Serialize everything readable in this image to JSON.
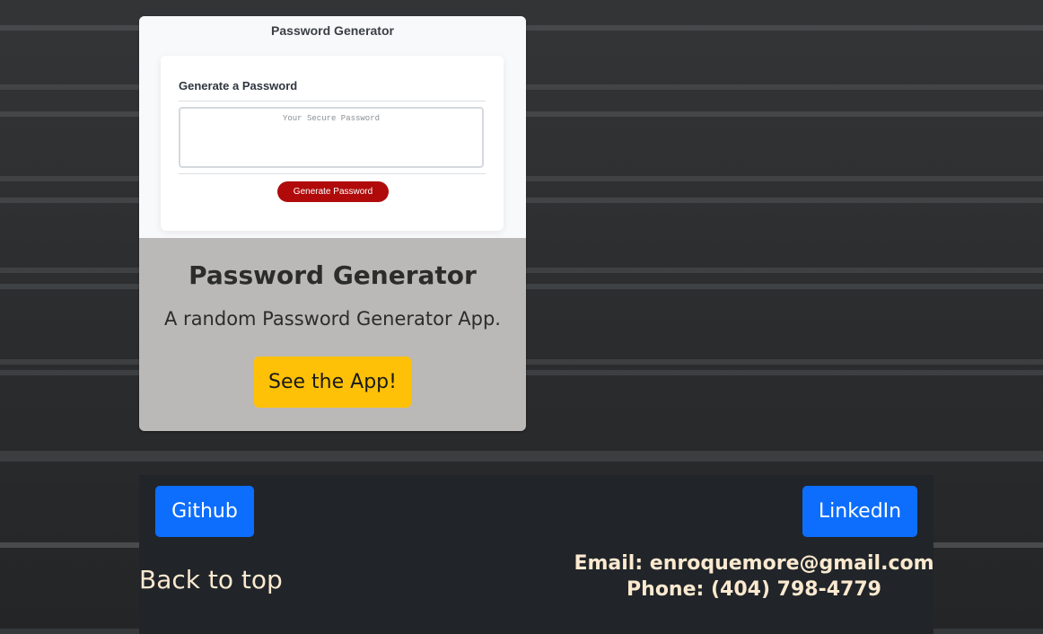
{
  "card": {
    "preview": {
      "title": "Password Generator",
      "heading": "Generate a Password",
      "placeholder": "Your Secure Password",
      "button_label": "Generate Password"
    },
    "title": "Password Generator",
    "description": "A random Password Generator App.",
    "button_label": "See the App!"
  },
  "footer": {
    "github_label": "Github",
    "linkedin_label": "LinkedIn",
    "back_to_top_label": "Back to top",
    "email_line": "Email: enroquemore@gmail.com",
    "phone_line": "Phone: (404) 798-4779"
  },
  "colors": {
    "card_body_bg": "#bbb9b7",
    "cta_yellow": "#ffc107",
    "primary_blue": "#0d6efd",
    "footer_bg": "#212529",
    "footer_text": "#fbe9d0",
    "preview_button_red": "#b00a0a"
  }
}
